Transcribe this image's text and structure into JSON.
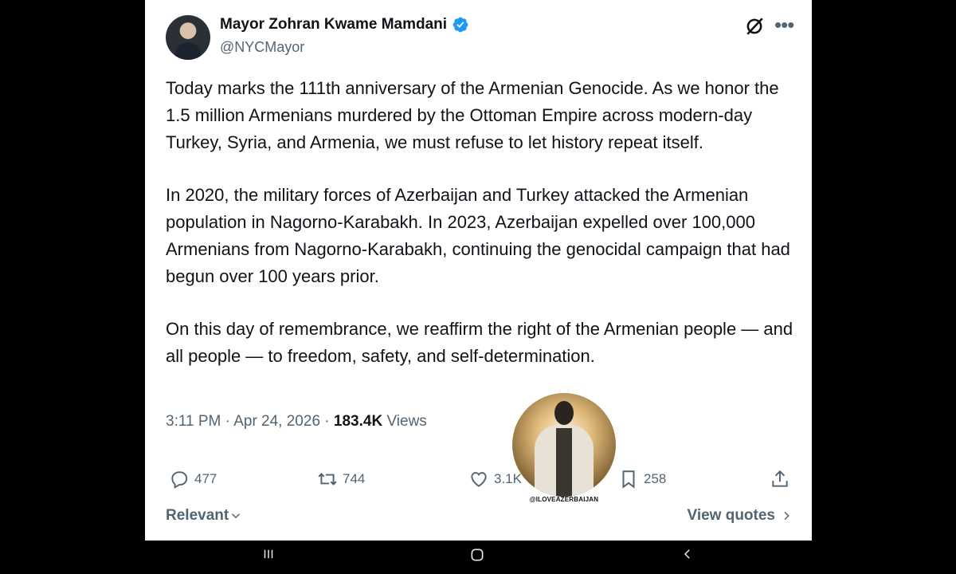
{
  "tweet": {
    "author_name": "Mayor Zohran Kwame Mamdani",
    "handle": "@NYCMayor",
    "paragraphs": [
      "Today marks the 111th anniversary of the Armenian Genocide. As we honor the 1.5 million Armenians murdered by the Ottoman Empire across modern-day Turkey, Syria, and Armenia, we must refuse to let history repeat itself.",
      "In 2020, the military forces of Azerbaijan and Turkey attacked the Armenian population in Nagorno-Karabakh. In 2023, Azerbaijan expelled over 100,000 Armenians from Nagorno-Karabakh, continuing the genocidal campaign that had begun over 100 years prior.",
      "On this day of remembrance, we reaffirm the right of the Armenian people — and all people — to freedom, safety, and self-determination."
    ],
    "time": "3:11 PM",
    "date": "Apr 24, 2026",
    "views_count": "183.4K",
    "views_label": "Views"
  },
  "actions": {
    "replies": "477",
    "reposts": "744",
    "likes": "3.1K",
    "bookmarks": "258"
  },
  "footer": {
    "sort_label": "Relevant",
    "view_quotes_label": "View quotes"
  },
  "watermark": {
    "text": "@ILOVEAZERBAIJAN"
  },
  "icons": [
    "verified-badge-icon",
    "grok-icon",
    "more-icon",
    "reply-icon",
    "repost-icon",
    "like-icon",
    "bookmark-icon",
    "share-icon",
    "chevron-down-icon",
    "chevron-right-icon",
    "recents-icon",
    "home-icon",
    "back-icon"
  ],
  "colors": {
    "text": "#0f1419",
    "secondary": "#536471",
    "verified": "#1d9bf0",
    "background": "#ffffff"
  }
}
